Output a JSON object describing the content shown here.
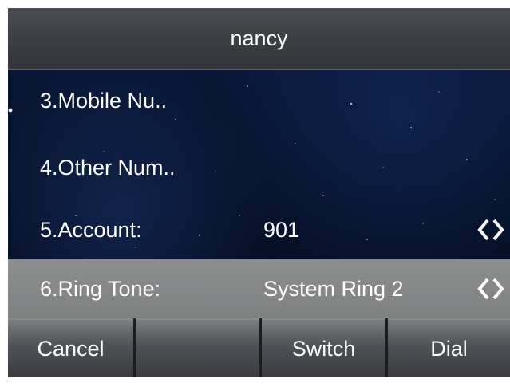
{
  "title": "nancy",
  "rows": [
    {
      "label": "3.Mobile Nu..",
      "value": ""
    },
    {
      "label": "4.Other Num..",
      "value": ""
    },
    {
      "label": "5.Account:",
      "value": "901",
      "has_arrows": true
    },
    {
      "label": "6.Ring Tone:",
      "value": "System Ring 2",
      "has_arrows": true,
      "selected": true
    }
  ],
  "softkeys": [
    "Cancel",
    "",
    "Switch",
    "Dial"
  ],
  "icons": {
    "switch_arrows": "left-right-arrows-icon"
  },
  "colors": {
    "title_bar": "#3c3f44",
    "selected_row": "#868889",
    "softkey": "#4e5155",
    "background": "#06122a",
    "text": "#ffffff"
  }
}
